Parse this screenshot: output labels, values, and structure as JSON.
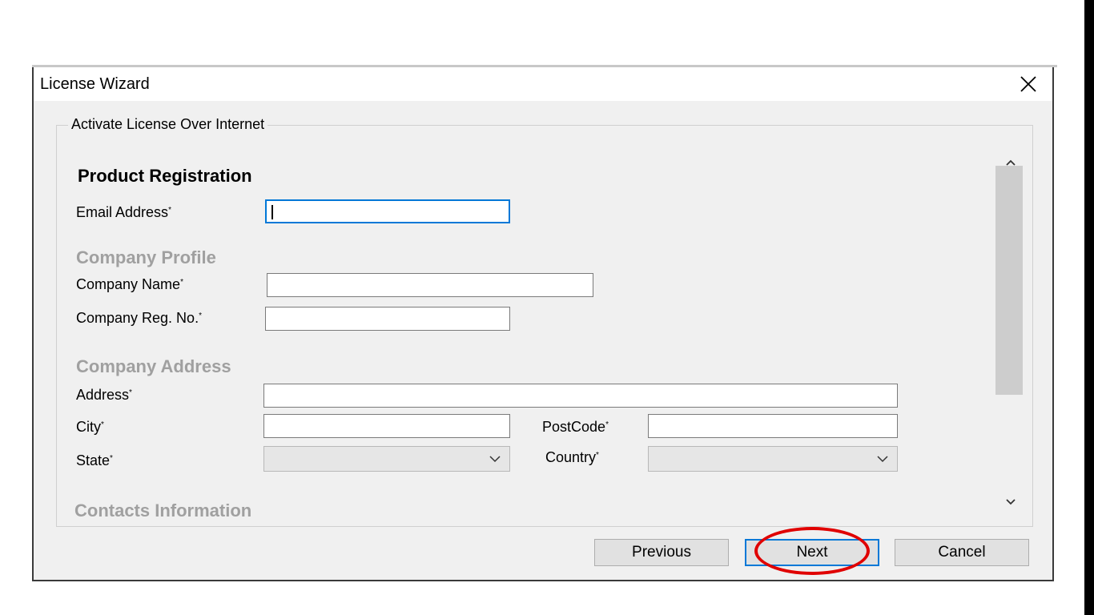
{
  "window": {
    "title": "License Wizard",
    "close_icon": "close-icon"
  },
  "group": {
    "label": "Activate License Over Internet"
  },
  "form": {
    "product_registration": {
      "heading": "Product Registration",
      "email_label": "Email Address",
      "email_value": ""
    },
    "company_profile": {
      "heading": "Company Profile",
      "name_label": "Company Name",
      "name_value": "",
      "reg_label": "Company Reg. No.",
      "reg_value": ""
    },
    "company_address": {
      "heading": "Company Address",
      "address_label": "Address",
      "address_value": "",
      "city_label": "City",
      "city_value": "",
      "postcode_label": "PostCode",
      "postcode_value": "",
      "state_label": "State",
      "state_value": "",
      "country_label": "Country",
      "country_value": ""
    },
    "contacts": {
      "heading": "Contacts Information"
    },
    "required_marker": "*"
  },
  "buttons": {
    "previous": "Previous",
    "next": "Next",
    "cancel": "Cancel"
  },
  "colors": {
    "focus": "#0078d7",
    "highlight": "#e00000"
  }
}
